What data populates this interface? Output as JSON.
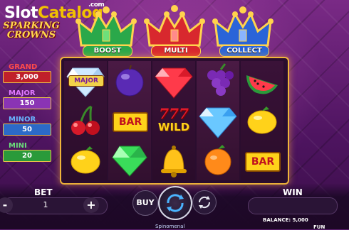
{
  "watermark": {
    "part1": "Slot",
    "part2": "Catalog",
    "suffix": ".com"
  },
  "logo": {
    "line1": "SPARKING",
    "line2": "CROWNS"
  },
  "crowns": [
    {
      "label": "BOOST",
      "color": "#2aa84a"
    },
    {
      "label": "MULTI",
      "color": "#d8282e"
    },
    {
      "label": "COLLECT",
      "color": "#2a64d8"
    }
  ],
  "jackpots": [
    {
      "name": "GRAND",
      "value": "3,000",
      "color": "#c0202a"
    },
    {
      "name": "MAJOR",
      "value": "150",
      "color": "#8a34b4"
    },
    {
      "name": "MINOR",
      "value": "50",
      "color": "#2c6ac8"
    },
    {
      "name": "MINI",
      "value": "20",
      "color": "#2a9a3a"
    }
  ],
  "reels": [
    [
      "diamond-major",
      "cherries",
      "lemon"
    ],
    [
      "plum",
      "bar",
      "green-gem"
    ],
    [
      "red-gem",
      "seven-wild",
      "bell"
    ],
    [
      "grapes",
      "blue-diamond",
      "orange"
    ],
    [
      "watermelon",
      "lemon",
      "bar"
    ]
  ],
  "symbol_text": {
    "major": "MAJOR",
    "bar": "BAR",
    "seven": "777",
    "wild": "WILD"
  },
  "controls": {
    "bet_label": "BET",
    "bet_value": "1",
    "minus": "-",
    "plus": "+",
    "buy": "BUY",
    "win_label": "WIN",
    "balance": "BALANCE: 5,000",
    "mode": "FUN",
    "provider": "Spinomenal"
  }
}
